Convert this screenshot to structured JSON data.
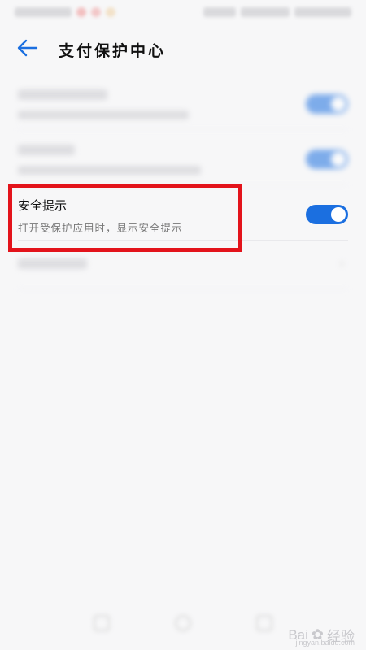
{
  "header": {
    "title": "支付保护中心"
  },
  "rows": [
    {
      "toggle_on": true
    },
    {
      "toggle_on": true
    },
    {
      "title": "安全提示",
      "subtitle": "打开受保护应用时，显示安全提示",
      "toggle_on": true
    },
    {}
  ],
  "colors": {
    "accent": "#1b6fe0",
    "highlight": "#e3131b",
    "background": "#f7f7f8"
  },
  "icons": {
    "back": "arrow-left-icon"
  },
  "watermark": {
    "brand": "Bai",
    "brand_suffix": "经验",
    "site": "jingyan.baidu.com"
  }
}
